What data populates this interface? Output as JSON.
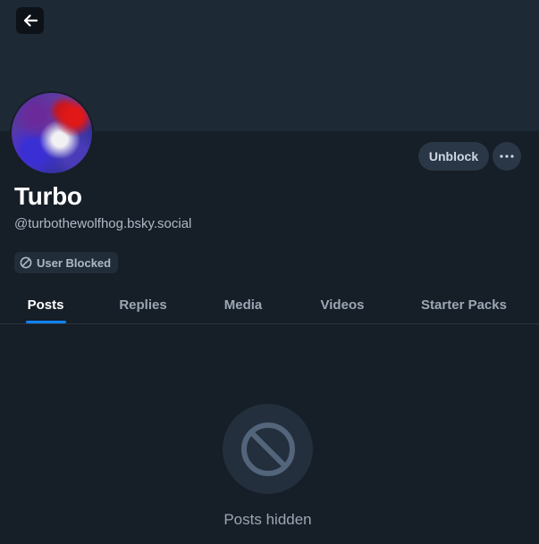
{
  "profile": {
    "display_name": "Turbo",
    "handle": "@turbothewolfhog.bsky.social",
    "blocked_badge": "User Blocked",
    "avatar_icon": "profile-avatar"
  },
  "actions": {
    "unblock_label": "Unblock",
    "more_icon": "more-horizontal-icon",
    "back_icon": "arrow-left-icon"
  },
  "tabs": [
    {
      "label": "Posts",
      "active": true
    },
    {
      "label": "Replies",
      "active": false
    },
    {
      "label": "Media",
      "active": false
    },
    {
      "label": "Videos",
      "active": false
    },
    {
      "label": "Starter Packs",
      "active": false
    }
  ],
  "content": {
    "empty_icon": "prohibited-icon",
    "empty_text": "Posts hidden"
  },
  "colors": {
    "background": "#161e27",
    "banner": "#1e2936",
    "accent": "#1083fe",
    "button": "#2a3746"
  }
}
